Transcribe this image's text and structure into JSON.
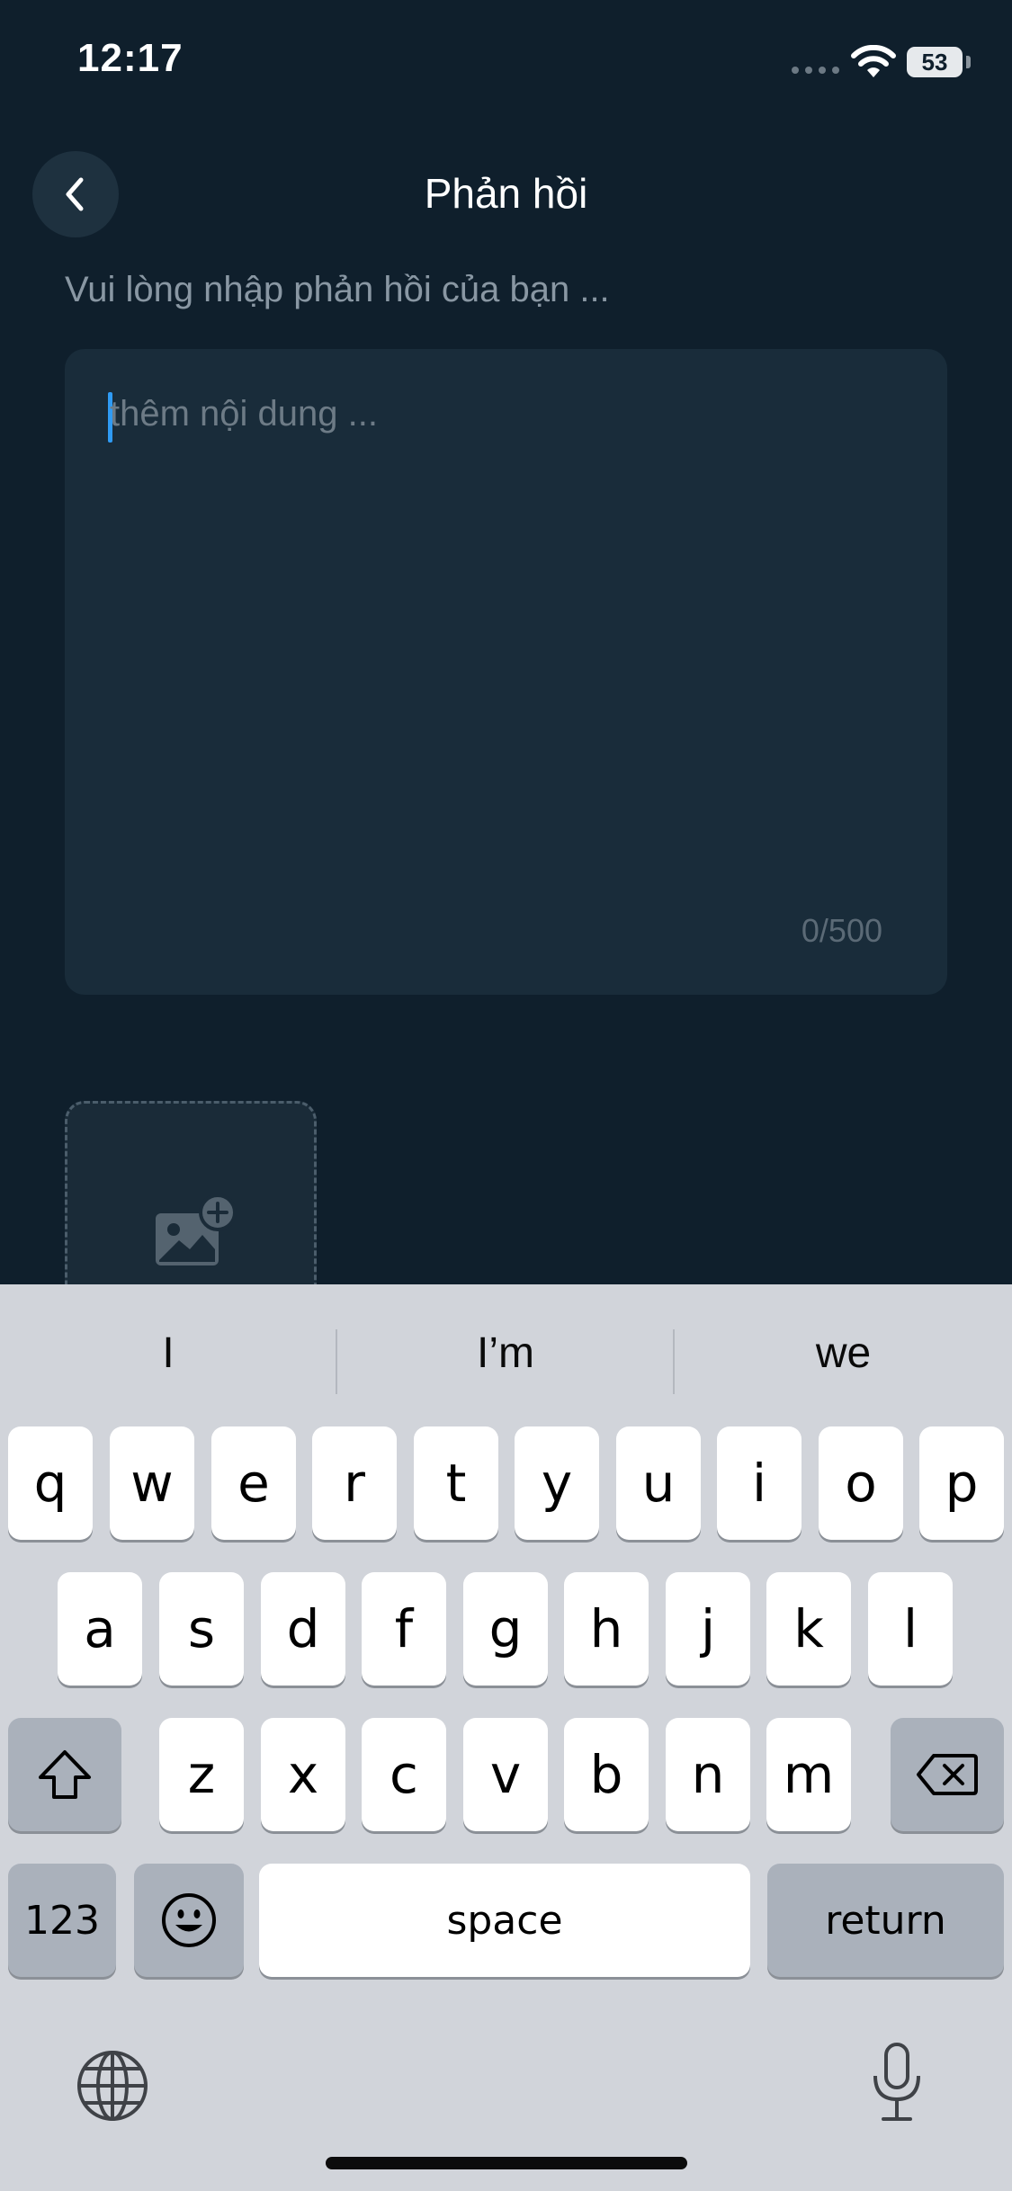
{
  "status_bar": {
    "time": "12:17",
    "battery": "53",
    "icons": [
      "cellular-signal-icon",
      "wifi-icon",
      "battery-icon"
    ]
  },
  "header": {
    "title": "Phản hồi",
    "back_icon": "chevron-left-icon"
  },
  "form": {
    "prompt": "Vui lòng nhập phản hồi của bạn ...",
    "placeholder": "thêm nội dung ...",
    "counter": "0/500",
    "image_icon": "add-image-icon"
  },
  "keyboard": {
    "suggestions": [
      "I",
      "I’m",
      "we"
    ],
    "row1": [
      "q",
      "w",
      "e",
      "r",
      "t",
      "y",
      "u",
      "i",
      "o",
      "p"
    ],
    "row2": [
      "a",
      "s",
      "d",
      "f",
      "g",
      "h",
      "j",
      "k",
      "l"
    ],
    "row3": [
      "z",
      "x",
      "c",
      "v",
      "b",
      "n",
      "m"
    ],
    "numbers_key": "123",
    "space_key": "space",
    "return_key": "return",
    "icons": [
      "shift-icon",
      "backspace-icon",
      "emoji-icon",
      "globe-icon",
      "microphone-icon"
    ]
  },
  "colors": {
    "background": "#0f1f2c",
    "field": "#192c3a",
    "cursor": "#2f9bf4",
    "keyboard": "#d1d4da"
  }
}
